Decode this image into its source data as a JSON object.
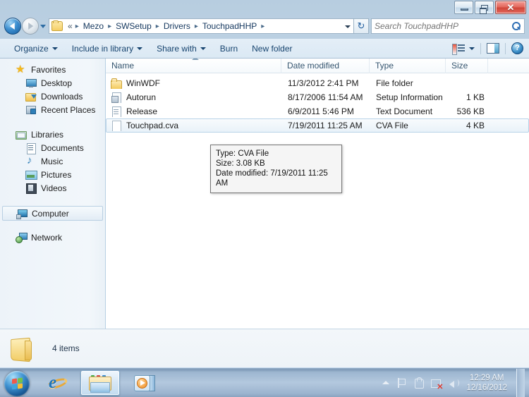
{
  "window": {
    "titlebar": {
      "minimize_label": "Minimize",
      "restore_label": "Restore",
      "close_label": "Close"
    }
  },
  "address_bar": {
    "back_label": "Back",
    "forward_label": "Forward",
    "recent_pages_label": "Recent Pages",
    "leading": "«",
    "crumbs": [
      "Mezo",
      "SWSetup",
      "Drivers",
      "TouchpadHHP"
    ],
    "separator": "▸",
    "refresh_label": "↻",
    "previous_locations_label": "Previous Locations"
  },
  "search": {
    "placeholder": "Search TouchpadHHP",
    "value": ""
  },
  "toolbar": {
    "items": [
      {
        "label": "Organize",
        "has_caret": true
      },
      {
        "label": "Include in library",
        "has_caret": true
      },
      {
        "label": "Share with",
        "has_caret": true
      },
      {
        "label": "Burn",
        "has_caret": false
      },
      {
        "label": "New folder",
        "has_caret": false
      }
    ],
    "views_label": "Change your view",
    "preview_label": "Show the preview pane",
    "help_label": "?"
  },
  "nav_pane": {
    "groups": [
      {
        "root": {
          "label": "Favorites",
          "icon": "star-icon"
        },
        "children": [
          {
            "label": "Desktop",
            "icon": "desktop-icon"
          },
          {
            "label": "Downloads",
            "icon": "downloads-icon"
          },
          {
            "label": "Recent Places",
            "icon": "recent-places-icon"
          }
        ]
      },
      {
        "root": {
          "label": "Libraries",
          "icon": "libraries-icon"
        },
        "children": [
          {
            "label": "Documents",
            "icon": "documents-icon"
          },
          {
            "label": "Music",
            "icon": "music-icon"
          },
          {
            "label": "Pictures",
            "icon": "pictures-icon"
          },
          {
            "label": "Videos",
            "icon": "videos-icon"
          }
        ]
      },
      {
        "root": {
          "label": "Computer",
          "icon": "computer-icon",
          "selected": true
        },
        "children": []
      },
      {
        "root": {
          "label": "Network",
          "icon": "network-icon"
        },
        "children": []
      }
    ]
  },
  "file_list": {
    "columns": [
      {
        "key": "name",
        "label": "Name",
        "sorted": "asc"
      },
      {
        "key": "date",
        "label": "Date modified"
      },
      {
        "key": "type",
        "label": "Type"
      },
      {
        "key": "size",
        "label": "Size"
      }
    ],
    "rows": [
      {
        "name": "WinWDF",
        "date": "11/3/2012 2:41 PM",
        "type": "File folder",
        "size": "",
        "icon": "folder-icon",
        "selected": false
      },
      {
        "name": "Autorun",
        "date": "8/17/2006 11:54 AM",
        "type": "Setup Information",
        "size": "1 KB",
        "icon": "inf-file-icon",
        "selected": false
      },
      {
        "name": "Release",
        "date": "6/9/2011 5:46 PM",
        "type": "Text Document",
        "size": "536 KB",
        "icon": "text-file-icon",
        "selected": false
      },
      {
        "name": "Touchpad.cva",
        "date": "7/19/2011 11:25 AM",
        "type": "CVA File",
        "size": "4 KB",
        "icon": "blank-file-icon",
        "selected": true
      }
    ]
  },
  "tooltip": {
    "lines": [
      "Type: CVA File",
      "Size: 3.08 KB",
      "Date modified: 7/19/2011 11:25 AM"
    ]
  },
  "details_bar": {
    "item_count": "4 items",
    "folder_icon": "folder-icon"
  },
  "taskbar": {
    "start_label": "Start",
    "tasks": [
      {
        "name": "internet-explorer",
        "active": false
      },
      {
        "name": "windows-explorer",
        "active": true
      },
      {
        "name": "windows-media-player",
        "active": false
      }
    ],
    "tray": {
      "show_hidden_label": "Show hidden icons",
      "icons": [
        "action-center-flag-icon",
        "action-center-icon",
        "network-disconnected-icon",
        "volume-icon"
      ],
      "time": "12:29 AM",
      "date": "12/16/2012"
    }
  },
  "colors": {
    "accent": "#1f74b8",
    "selection": "#e9f2f9",
    "close_button": "#cf4437",
    "folder_yellow": "#f3c95c"
  }
}
